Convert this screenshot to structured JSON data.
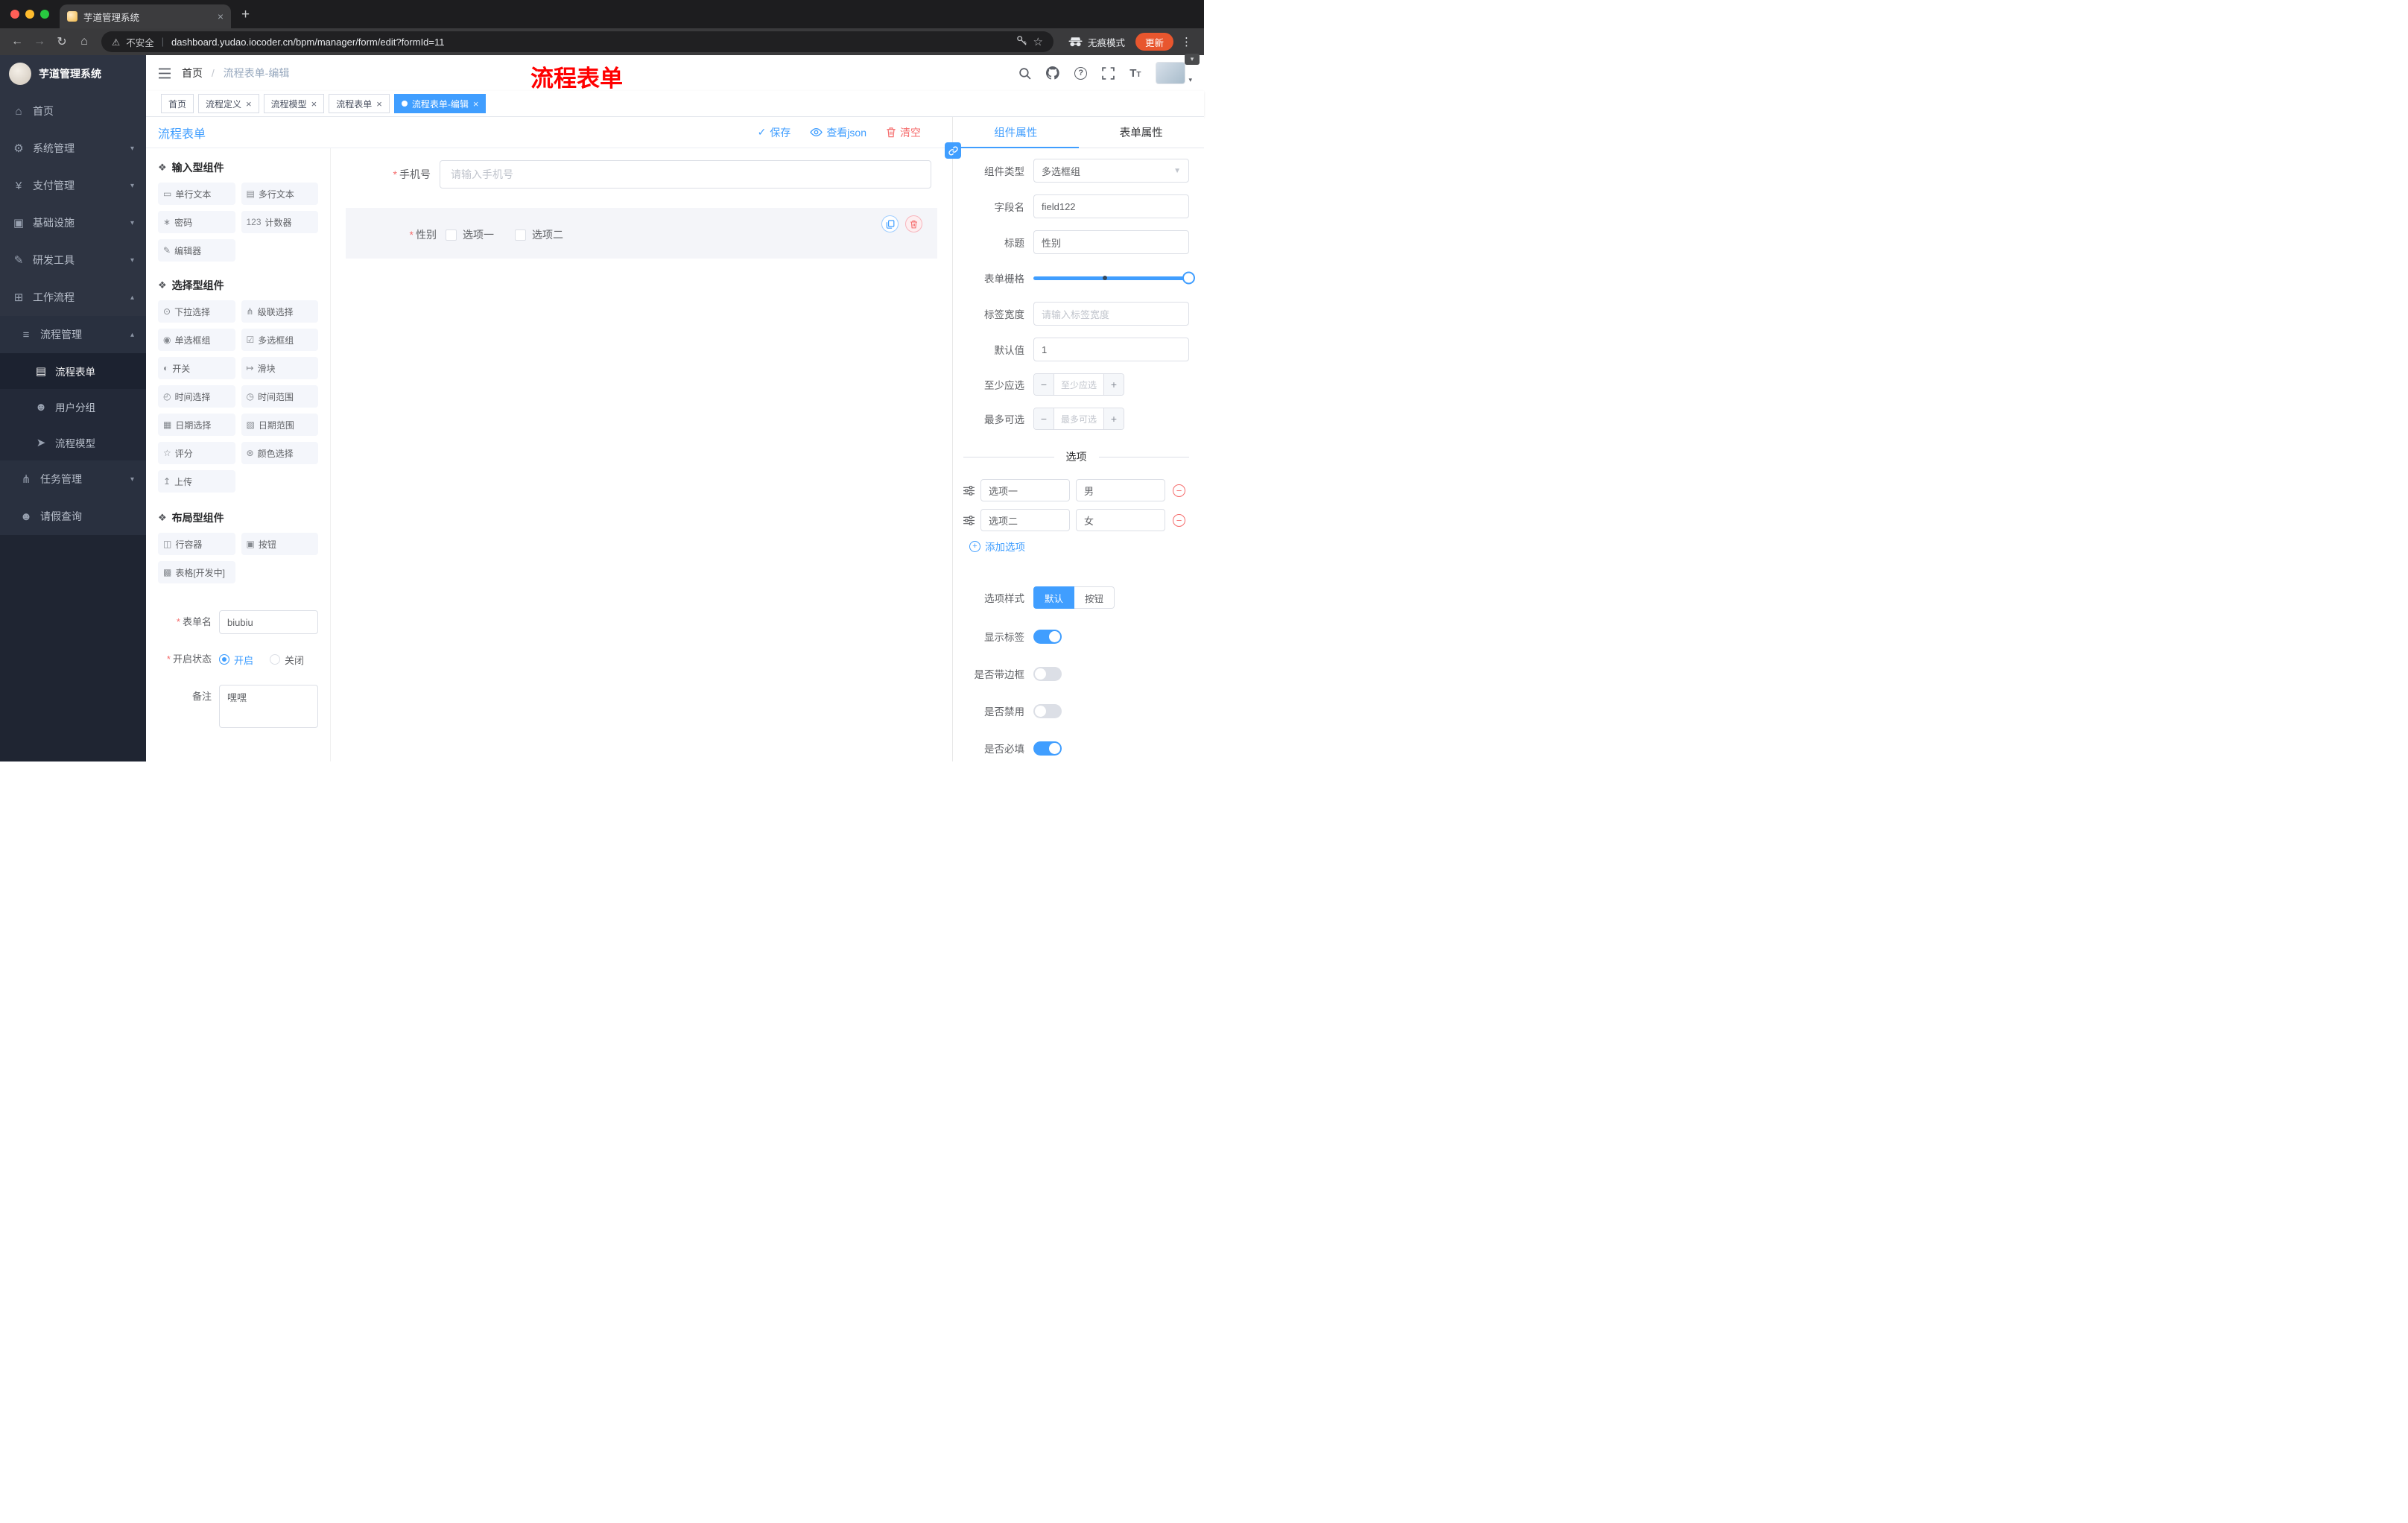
{
  "chrome": {
    "tab_title": "芋道管理系统",
    "security_label": "不安全",
    "url": "dashboard.yudao.iocoder.cn/bpm/manager/form/edit?formId=11",
    "incognito_label": "无痕模式",
    "update_label": "更新"
  },
  "annotation": {
    "title": "流程表单",
    "color": "#ff0000"
  },
  "sidebar": {
    "logo_title": "芋道管理系统",
    "menu": [
      {
        "label": "首页",
        "icon": "dashboard",
        "depth": 0
      },
      {
        "label": "系统管理",
        "icon": "gear",
        "depth": 0,
        "chevron": "down"
      },
      {
        "label": "支付管理",
        "icon": "yen",
        "depth": 0,
        "chevron": "down"
      },
      {
        "label": "基础设施",
        "icon": "infra",
        "depth": 0,
        "chevron": "down"
      },
      {
        "label": "研发工具",
        "icon": "tool",
        "depth": 0,
        "chevron": "down"
      },
      {
        "label": "工作流程",
        "icon": "workflow",
        "depth": 0,
        "chevron": "up"
      },
      {
        "label": "流程管理",
        "icon": "list",
        "depth": 1,
        "chevron": "up"
      },
      {
        "label": "流程表单",
        "icon": "doc",
        "depth": 2,
        "active": true
      },
      {
        "label": "用户分组",
        "icon": "chat",
        "depth": 2
      },
      {
        "label": "流程模型",
        "icon": "send",
        "depth": 2
      },
      {
        "label": "任务管理",
        "icon": "tree",
        "depth": 1,
        "chevron": "down"
      },
      {
        "label": "请假查询",
        "icon": "user",
        "depth": 1
      }
    ]
  },
  "navbar": {
    "breadcrumb": [
      "首页",
      "流程表单-编辑"
    ]
  },
  "tags_view": [
    {
      "label": "首页",
      "closable": false,
      "active": false
    },
    {
      "label": "流程定义",
      "closable": true,
      "active": false
    },
    {
      "label": "流程模型",
      "closable": true,
      "active": false
    },
    {
      "label": "流程表单",
      "closable": true,
      "active": false
    },
    {
      "label": "流程表单-编辑",
      "closable": true,
      "active": true
    }
  ],
  "designer": {
    "title": "流程表单",
    "actions": {
      "save": "保存",
      "view_json": "查看json",
      "clear": "清空"
    },
    "palette_groups": [
      {
        "title": "输入型组件",
        "items": [
          {
            "label": "单行文本",
            "icon": "input"
          },
          {
            "label": "多行文本",
            "icon": "textarea"
          },
          {
            "label": "密码",
            "icon": "password"
          },
          {
            "label": "计数器",
            "icon": "counter"
          },
          {
            "label": "编辑器",
            "icon": "editor"
          }
        ]
      },
      {
        "title": "选择型组件",
        "items": [
          {
            "label": "下拉选择",
            "icon": "select"
          },
          {
            "label": "级联选择",
            "icon": "cascader"
          },
          {
            "label": "单选框组",
            "icon": "radio"
          },
          {
            "label": "多选框组",
            "icon": "checkbox"
          },
          {
            "label": "开关",
            "icon": "switch"
          },
          {
            "label": "滑块",
            "icon": "slider"
          },
          {
            "label": "时间选择",
            "icon": "time"
          },
          {
            "label": "时间范围",
            "icon": "time-range"
          },
          {
            "label": "日期选择",
            "icon": "date"
          },
          {
            "label": "日期范围",
            "icon": "date-range"
          },
          {
            "label": "评分",
            "icon": "rate"
          },
          {
            "label": "颜色选择",
            "icon": "color"
          },
          {
            "label": "上传",
            "icon": "upload"
          }
        ]
      },
      {
        "title": "布局型组件",
        "items": [
          {
            "label": "行容器",
            "icon": "row"
          },
          {
            "label": "按钮",
            "icon": "button"
          },
          {
            "label": "表格[开发中]",
            "icon": "table"
          }
        ]
      }
    ],
    "form_meta": {
      "name_label": "表单名",
      "name_value": "biubiu",
      "status_label": "开启状态",
      "status_options": [
        {
          "label": "开启",
          "selected": true
        },
        {
          "label": "关闭",
          "selected": false
        }
      ],
      "remark_label": "备注",
      "remark_value": "嘿嘿"
    },
    "canvas": {
      "phone": {
        "label": "手机号",
        "placeholder": "请输入手机号"
      },
      "gender": {
        "label": "性别",
        "options": [
          "选项一",
          "选项二"
        ]
      }
    }
  },
  "properties": {
    "tabs": [
      {
        "label": "组件属性",
        "active": true
      },
      {
        "label": "表单属性",
        "active": false
      }
    ],
    "component_type": {
      "label": "组件类型",
      "value": "多选框组"
    },
    "field_name": {
      "label": "字段名",
      "value": "field122"
    },
    "title_field": {
      "label": "标题",
      "value": "性别"
    },
    "grid": {
      "label": "表单栅格"
    },
    "label_width": {
      "label": "标签宽度",
      "placeholder": "请输入标签宽度"
    },
    "default_value": {
      "label": "默认值",
      "value": "1"
    },
    "min_select": {
      "label": "至少应选",
      "placeholder": "至少应选"
    },
    "max_select": {
      "label": "最多可选",
      "placeholder": "最多可选"
    },
    "options_divider": "选项",
    "options": [
      {
        "label": "选项一",
        "value": "男"
      },
      {
        "label": "选项二",
        "value": "女"
      }
    ],
    "add_option": "添加选项",
    "option_style": {
      "label": "选项样式",
      "options": [
        {
          "label": "默认",
          "active": true
        },
        {
          "label": "按钮",
          "active": false
        }
      ]
    },
    "switches": [
      {
        "label": "显示标签",
        "on": true
      },
      {
        "label": "是否带边框",
        "on": false
      },
      {
        "label": "是否禁用",
        "on": false
      },
      {
        "label": "是否必填",
        "on": true
      }
    ]
  },
  "colors": {
    "accent": "#409eff",
    "danger": "#f56c6c"
  }
}
